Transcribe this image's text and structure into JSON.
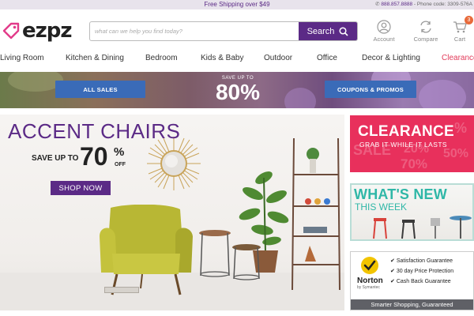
{
  "topbar": {
    "shipping": "Free Shipping over $49",
    "phone_number": "888.857.8888",
    "phone_code": " - Phone code: 3309-576A"
  },
  "header": {
    "logo_text": "ezpz",
    "search_placeholder": "what can we help you find today?",
    "search_button": "Search",
    "account_label": "Account",
    "compare_label": "Compare",
    "cart_label": "Cart",
    "cart_count": "3"
  },
  "nav": {
    "items": [
      "Living Room",
      "Kitchen & Dining",
      "Bedroom",
      "Kids & Baby",
      "Outdoor",
      "Office",
      "Decor & Lighting",
      "Clearance"
    ]
  },
  "sales_banner": {
    "all_sales": "ALL SALES",
    "save_up_to": "SAVE UP TO",
    "percent": "80%",
    "coupons": "COUPONS & PROMOS"
  },
  "hero": {
    "title": "ACCENT CHAIRS",
    "save_up_to": "SAVE UP TO",
    "percent": "70",
    "percent_sign": "%",
    "off": "OFF",
    "shop_now": "SHOP NOW"
  },
  "tiles": {
    "clearance_title": "CLEARANCE",
    "clearance_sub": "GRAB IT WHILE IT LASTS",
    "clearance_bg": [
      "SALE",
      "20%",
      "50%",
      "70%",
      "%"
    ],
    "new_title": "WHAT'S NEW",
    "new_sub": "THIS WEEK",
    "norton_items": [
      "Satisfaction Guarantee",
      "30 day Price Protection",
      "Cash Back Guarantee"
    ],
    "norton_brand": "Norton",
    "norton_sub": "by Symantec",
    "norton_footer": "Smarter Shopping, Guaranteed"
  },
  "colors": {
    "brand_purple": "#5b2a86",
    "clearance_red": "#e8305c",
    "teal": "#2fb7a7",
    "blue_button": "#3a6bb8",
    "cart_badge": "#e86a3a"
  }
}
